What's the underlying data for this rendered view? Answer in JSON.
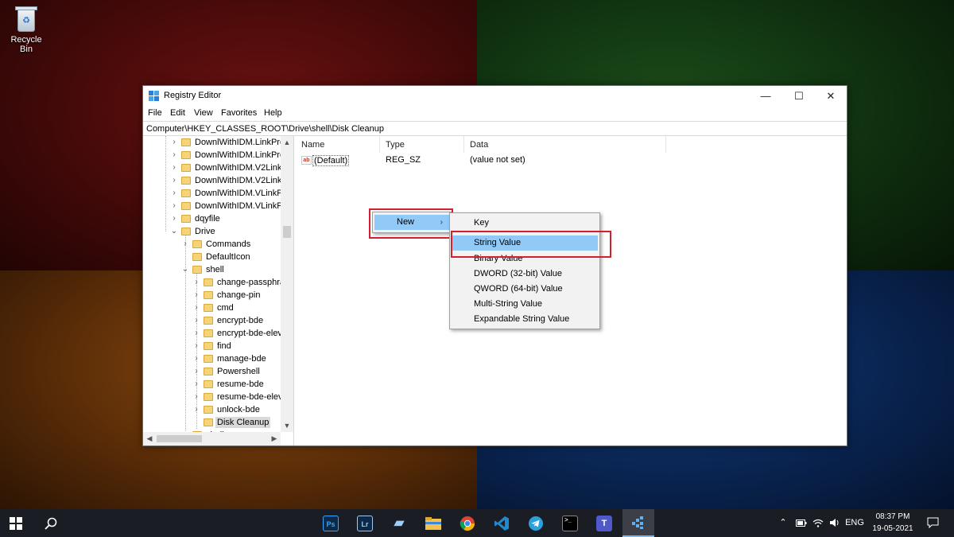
{
  "desktop": {
    "recycle_bin_label": "Recycle Bin"
  },
  "window": {
    "title": "Registry Editor",
    "controls": {
      "minimize": "—",
      "maximize": "☐",
      "close": "✕"
    },
    "menu": [
      "File",
      "Edit",
      "View",
      "Favorites",
      "Help"
    ],
    "address": "Computer\\HKEY_CLASSES_ROOT\\Drive\\shell\\Disk Cleanup"
  },
  "tree": {
    "items": [
      {
        "label": "DownlWithIDM.LinkPro"
      },
      {
        "label": "DownlWithIDM.LinkPro"
      },
      {
        "label": "DownlWithIDM.V2LinkP"
      },
      {
        "label": "DownlWithIDM.V2LinkP"
      },
      {
        "label": "DownlWithIDM.VLinkPr"
      },
      {
        "label": "DownlWithIDM.VLinkPr"
      },
      {
        "label": "dqyfile"
      },
      {
        "label": "Drive"
      },
      {
        "label": "Commands"
      },
      {
        "label": "DefaultIcon"
      },
      {
        "label": "shell"
      },
      {
        "label": "change-passphra"
      },
      {
        "label": "change-pin"
      },
      {
        "label": "cmd"
      },
      {
        "label": "encrypt-bde"
      },
      {
        "label": "encrypt-bde-elev"
      },
      {
        "label": "find"
      },
      {
        "label": "manage-bde"
      },
      {
        "label": "Powershell"
      },
      {
        "label": "resume-bde"
      },
      {
        "label": "resume-bde-elev"
      },
      {
        "label": "unlock-bde"
      },
      {
        "label": "Disk Cleanup"
      },
      {
        "label": "shellex"
      }
    ]
  },
  "list": {
    "columns": [
      "Name",
      "Type",
      "Data"
    ],
    "rows": [
      {
        "name": "(Default)",
        "type": "REG_SZ",
        "data": "(value not set)"
      }
    ]
  },
  "context_menu": {
    "parent_item": "New",
    "submenu": [
      "Key",
      "String Value",
      "Binary Value",
      "DWORD (32-bit) Value",
      "QWORD (64-bit) Value",
      "Multi-String Value",
      "Expandable String Value"
    ],
    "highlighted": "String Value"
  },
  "taskbar": {
    "apps": [
      "Ps",
      "Lr"
    ],
    "language": "ENG",
    "time": "08:37 PM",
    "date": "19-05-2021"
  },
  "colors": {
    "menu_highlight": "#91c9f7",
    "annotation_red": "#d4202e",
    "folder": "#f6d376",
    "taskbar": "#1b1d24"
  }
}
